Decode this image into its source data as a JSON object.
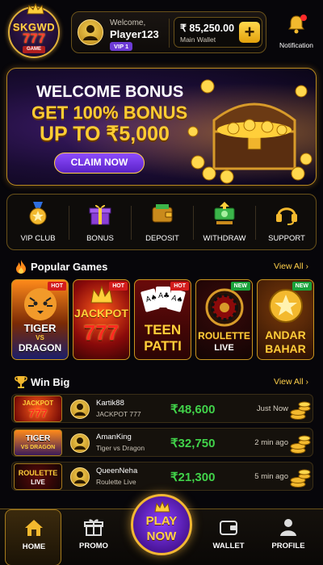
{
  "brand": {
    "line1": "SKGWD",
    "line2": "777",
    "line3": "GAME",
    "icon": "crown-icon"
  },
  "user": {
    "welcome": "Welcome,",
    "name": "Player123",
    "vip": "VIP 1",
    "balance": "₹ 85,250.00",
    "wallet_label": "Main Wallet",
    "add_label": "+"
  },
  "notification": {
    "label": "Notification",
    "icon": "bell-icon"
  },
  "banner": {
    "line1": "WELCOME BONUS",
    "line2": "GET 100% BONUS",
    "line3": "UP TO ₹5,000",
    "cta": "CLAIM NOW"
  },
  "quick_actions": [
    {
      "label": "VIP CLUB",
      "icon": "vip-medal-icon"
    },
    {
      "label": "BONUS",
      "icon": "gift-icon"
    },
    {
      "label": "DEPOSIT",
      "icon": "wallet-icon"
    },
    {
      "label": "WITHDRAW",
      "icon": "cash-icon"
    },
    {
      "label": "SUPPORT",
      "icon": "headset-icon"
    }
  ],
  "popular": {
    "title": "Popular Games",
    "view_all": "View All",
    "games": [
      {
        "line1": "TIGER",
        "line2": "VS",
        "line3": "DRAGON",
        "tag": "HOT"
      },
      {
        "line1": "JACKPOT",
        "line2": "777",
        "tag": "HOT"
      },
      {
        "line1": "TEEN",
        "line2": "PATTI",
        "tag": "HOT"
      },
      {
        "line1": "ROULETTE",
        "line2": "LIVE",
        "tag": "NEW"
      },
      {
        "line1": "ANDAR",
        "line2": "BAHAR",
        "tag": "NEW"
      }
    ]
  },
  "winbig": {
    "title": "Win Big",
    "view_all": "View All",
    "rows": [
      {
        "thumb1": "JACKPOT",
        "thumb2": "777",
        "user": "Kartik88",
        "game": "JACKPOT 777",
        "amount": "₹48,600",
        "time": "Just Now"
      },
      {
        "thumb1": "TIGER",
        "thumb2": "VS DRAGON",
        "user": "AmanKing",
        "game": "Tiger vs Dragon",
        "amount": "₹32,750",
        "time": "2 min ago"
      },
      {
        "thumb1": "ROULETTE",
        "thumb2": "LIVE",
        "user": "QueenNeha",
        "game": "Roulette Live",
        "amount": "₹21,300",
        "time": "5 min ago"
      }
    ]
  },
  "nav": {
    "home": "HOME",
    "promo": "PROMO",
    "play1": "PLAY",
    "play2": "NOW",
    "wallet": "WALLET",
    "profile": "PROFILE"
  },
  "colors": {
    "gold": "#ffcc33",
    "win_green": "#41d34a",
    "purple": "#6d3bd6",
    "hot": "#d41c1c",
    "new": "#1aa23a"
  }
}
